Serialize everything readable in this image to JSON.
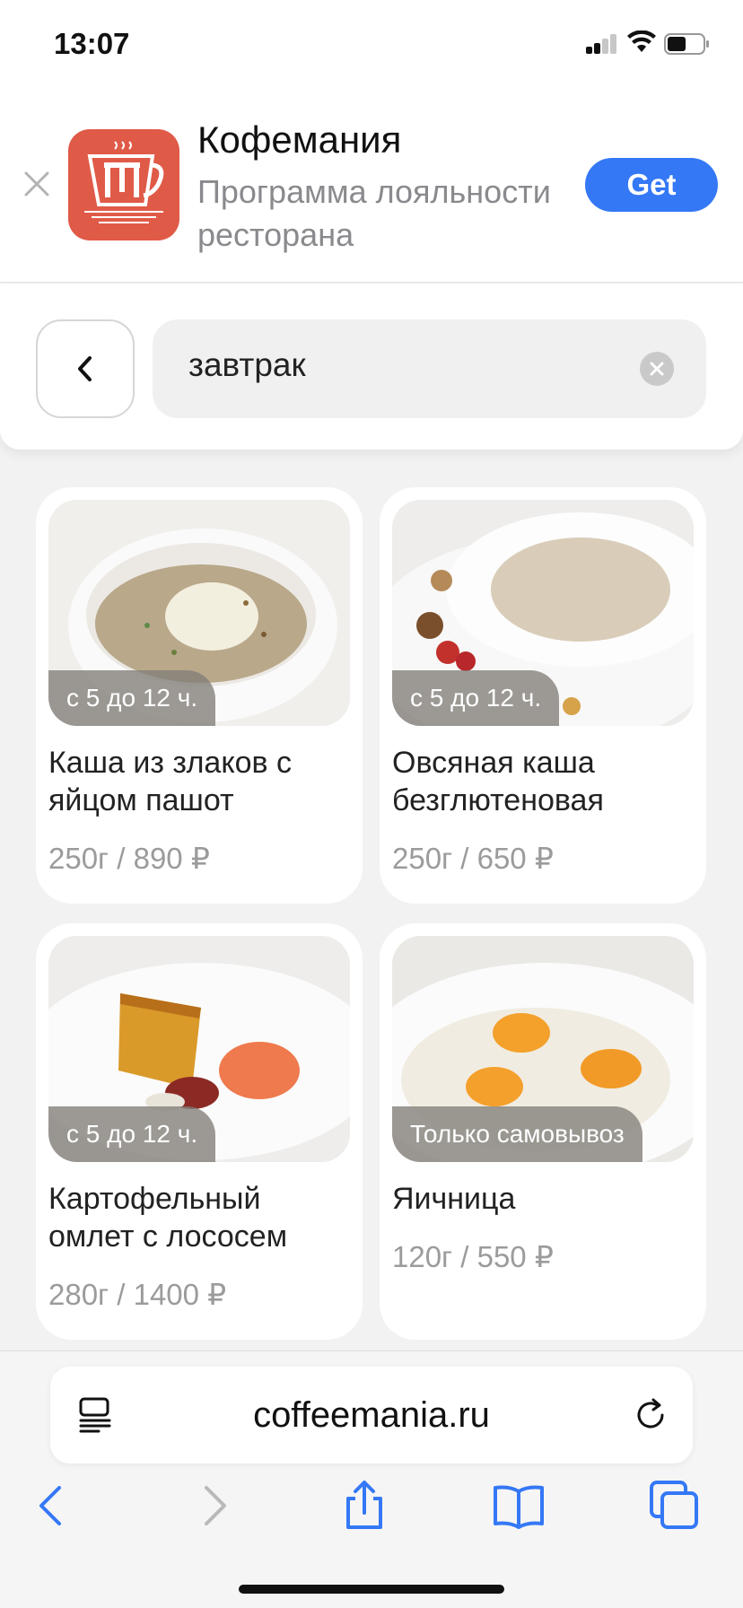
{
  "status_bar": {
    "time": "13:07"
  },
  "app_banner": {
    "app_name": "Кофемания",
    "subtitle": "Программа лояльности ресторана",
    "get_label": "Get"
  },
  "search": {
    "query": "завтрак"
  },
  "products": [
    {
      "badge": "с 5 до 12 ч.",
      "title": "Каша из злаков с яйцом пашот",
      "price": "250г / 890 ₽"
    },
    {
      "badge": "с 5 до 12 ч.",
      "title": "Овсяная каша безглютеновая",
      "price": "250г / 650 ₽"
    },
    {
      "badge": "с 5 до 12 ч.",
      "title": "Картофельный омлет с лососем",
      "price": "280г / 1400 ₽"
    },
    {
      "badge": "Только самовывоз",
      "title": "Яичница",
      "price": "120г / 550 ₽"
    }
  ],
  "browser": {
    "url": "coffeemania.ru"
  },
  "colors": {
    "accent": "#3478f6",
    "app_icon": "#e05a48",
    "price_grey": "#9b9b9b"
  },
  "icons": [
    "close-icon",
    "cup-logo-icon",
    "chevron-left-icon",
    "clear-icon",
    "reader-icon",
    "reload-icon",
    "back-arrow-icon",
    "forward-arrow-icon",
    "share-icon",
    "bookmarks-icon",
    "tabs-icon"
  ]
}
